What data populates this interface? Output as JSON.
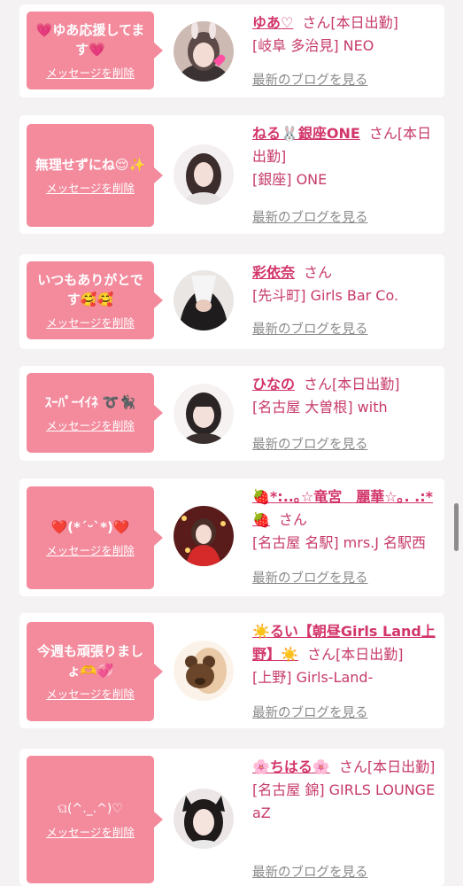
{
  "delete_label": "メッセージを削除",
  "blog_label": "最新のブログを見る",
  "san_label": "さん",
  "cards": [
    {
      "message": "💗ゆあ応援してます💗",
      "name": "ゆあ♡",
      "status": "[本日出勤]",
      "shop": "[岐阜 多治見] NEO"
    },
    {
      "message": "無理せずにね😌✨",
      "name": "ねる🐰銀座ONE",
      "status": "[本日出勤]",
      "shop": "[銀座] ONE"
    },
    {
      "message": "いつもありがとです🥰🥰",
      "name": "彩依奈",
      "status": "",
      "shop": "[先斗町] Girls Bar Co."
    },
    {
      "message": "ｽｰﾊﾟｰｲｲﾈ ➰🐈‍⬛",
      "name": "ひなの",
      "status": "[本日出勤]",
      "shop": "[名古屋 大曽根] with"
    },
    {
      "message": "❤️(*´ᵕ`*)❤️",
      "name": "🍓*:..｡☆竜宮　麗華☆｡. .:*🍓",
      "status": "",
      "shop": "[名古屋 名駅] mrs.J 名駅西"
    },
    {
      "message": "今週も頑張りましょ🫶💞",
      "name": "☀️るい【朝昼Girls Land上野】☀️",
      "status": "[本日出勤]",
      "shop": "[上野] Girls-Land-"
    },
    {
      "message": "ଘ(^._.^)♡",
      "name": "🌸ちはる🌸",
      "status": "[本日出勤]",
      "shop": "[名古屋 錦] GIRLS LOUNGE aZ"
    }
  ]
}
